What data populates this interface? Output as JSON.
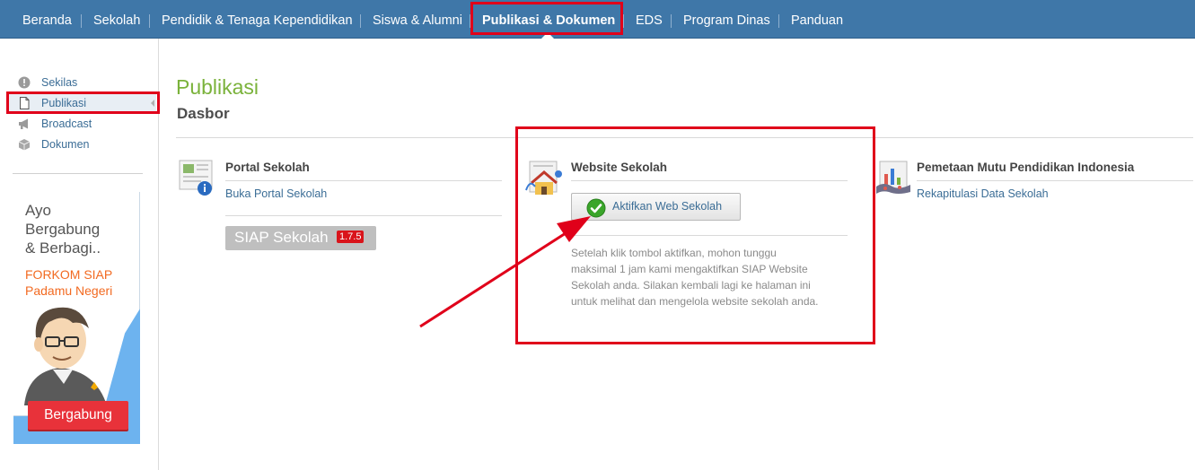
{
  "nav": {
    "items": [
      {
        "label": "Beranda"
      },
      {
        "label": "Sekolah"
      },
      {
        "label": "Pendidik & Tenaga Kependidikan"
      },
      {
        "label": "Siswa & Alumni"
      },
      {
        "label": "Publikasi & Dokumen",
        "active": true
      },
      {
        "label": "EDS"
      },
      {
        "label": "Program Dinas"
      },
      {
        "label": "Panduan"
      }
    ]
  },
  "sidebar": {
    "items": [
      {
        "label": "Sekilas",
        "icon": "info-circle-icon"
      },
      {
        "label": "Publikasi",
        "icon": "document-icon",
        "active": true
      },
      {
        "label": "Broadcast",
        "icon": "megaphone-icon"
      },
      {
        "label": "Dokumen",
        "icon": "box-icon"
      }
    ]
  },
  "banner": {
    "line1": "Ayo",
    "line2": "Bergabung",
    "line3": "& Berbagi..",
    "org1": "FORKOM SIAP",
    "org2": "Padamu Negeri",
    "button": "Bergabung"
  },
  "main": {
    "title": "Publikasi",
    "subtitle": "Dasbor",
    "cards": [
      {
        "title": "Portal Sekolah",
        "link": "Buka Portal Sekolah",
        "badge_text": "SIAP Sekolah",
        "badge_version": "1.7.5"
      },
      {
        "title": "Website Sekolah",
        "button": "Aktifkan Web Sekolah",
        "info": [
          "Setelah klik tombol aktifkan, mohon tunggu",
          "maksimal 1 jam kami mengaktifkan SIAP Website",
          "Sekolah anda. Silakan kembali lagi ke halaman ini",
          "untuk melihat dan mengelola website sekolah anda."
        ]
      },
      {
        "title": "Pemetaan Mutu Pendidikan Indonesia",
        "link": "Rekapitulasi Data Sekolah"
      }
    ]
  },
  "colors": {
    "nav_bg": "#3f77a8",
    "title_green": "#7ab23a",
    "link_blue": "#3b6d96",
    "highlight_red": "#e0001a",
    "banner_blue": "#6db3ef",
    "banner_button": "#e8323a"
  }
}
